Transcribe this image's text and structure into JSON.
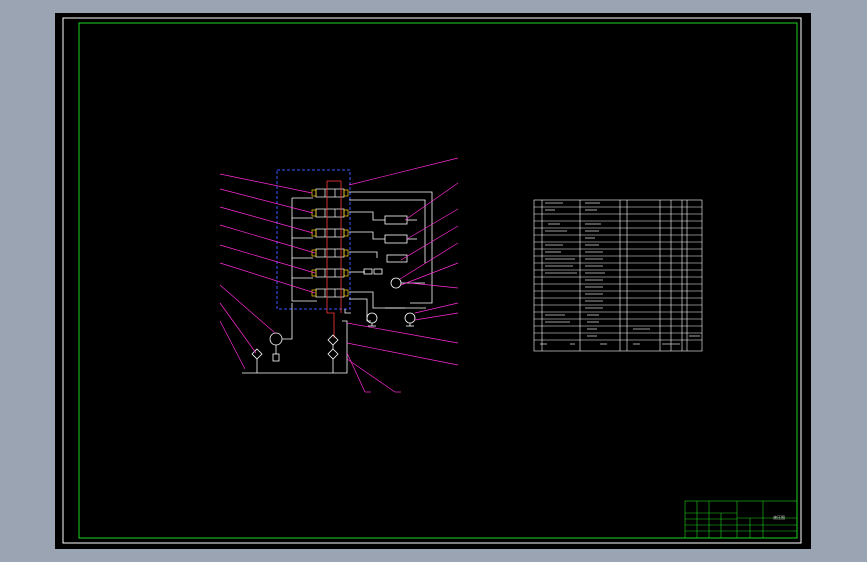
{
  "drawing": {
    "sheet_color": "#000000",
    "border_color": "#ffffff",
    "frame_color": "#1fd21f",
    "circuit_color": "#ffffff",
    "leader_color": "#ff2bd6",
    "boundary_color": "#3b57ff",
    "valve_color": "#ffd000",
    "pipe_color": "#ff3a3a"
  },
  "title_block": {
    "drawing_name": "液压图"
  }
}
